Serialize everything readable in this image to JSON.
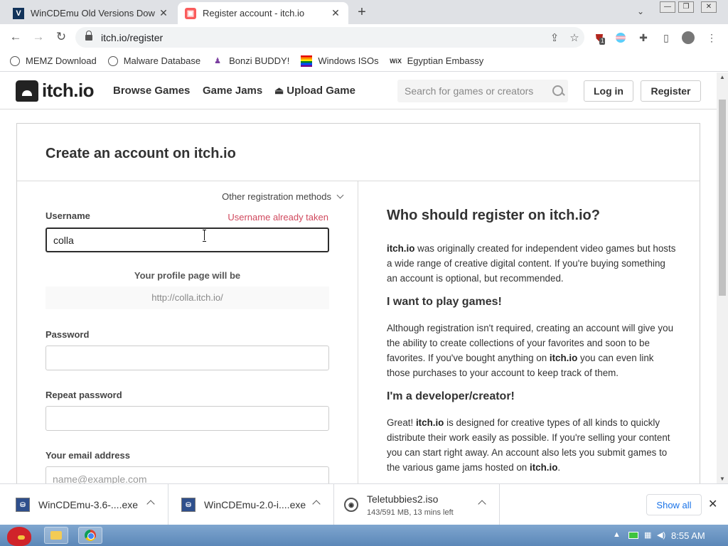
{
  "browser": {
    "tabs": [
      {
        "title": "WinCDEmu Old Versions Dow",
        "favicon": "wincdemu-icon",
        "active": false
      },
      {
        "title": "Register account - itch.io",
        "favicon": "itch-icon",
        "active": true
      }
    ],
    "new_tab": "+",
    "url": "itch.io/register",
    "bookmarks": [
      {
        "label": "MEMZ Download",
        "icon": "globe-icon"
      },
      {
        "label": "Malware Database",
        "icon": "globe-icon"
      },
      {
        "label": "Bonzi BUDDY!",
        "icon": "bonzi-icon"
      },
      {
        "label": "Windows ISOs",
        "icon": "rainbow-flag-icon"
      },
      {
        "label": "Egyptian Embassy",
        "icon": "wix-icon"
      }
    ],
    "extension_badge": "1"
  },
  "site": {
    "logo_text": "itch.io",
    "nav": [
      "Browse Games",
      "Game Jams",
      "Upload Game"
    ],
    "search_placeholder": "Search for games or creators",
    "login_label": "Log in",
    "register_label": "Register"
  },
  "form": {
    "title": "Create an account on itch.io",
    "other_methods": "Other registration methods",
    "username_label": "Username",
    "username_error": "Username already taken",
    "username_value": "colla",
    "profile_label": "Your profile page will be",
    "profile_url": "http://colla.itch.io/",
    "password_label": "Password",
    "repeat_password_label": "Repeat password",
    "email_label": "Your email address",
    "email_placeholder": "name@example.com"
  },
  "info": {
    "heading": "Who should register on itch.io?",
    "p1_brand": "itch.io",
    "p1_rest": " was originally created for independent video games but hosts a wide range of creative digital content. If you're buying something an account is optional, but recommended.",
    "h_play": "I want to play games!",
    "p2_a": "Although registration isn't required, creating an account will give you the ability to create collections of your favorites and soon to be favorites. If you've bought anything on ",
    "p2_brand": "itch.io",
    "p2_b": " you can even link those purchases to your account to keep track of them.",
    "h_dev": "I'm a developer/creator!",
    "p3_a": "Great! ",
    "p3_brand": "itch.io",
    "p3_b": " is designed for creative types of all kinds to quickly distribute their work easily as possible. If you're selling your content you can start right away. An account also lets you submit games to the various game jams hosted on ",
    "p3_brand2": "itch.io",
    "p3_c": "."
  },
  "downloads": [
    {
      "name": "WinCDEmu-3.6-....exe",
      "type": "exe"
    },
    {
      "name": "WinCDEmu-2.0-i....exe",
      "type": "exe"
    },
    {
      "name": "Teletubbies2.iso",
      "status": "143/591 MB, 13 mins left",
      "type": "iso"
    }
  ],
  "show_all": "Show all",
  "taskbar": {
    "clock": "8:55 AM"
  }
}
